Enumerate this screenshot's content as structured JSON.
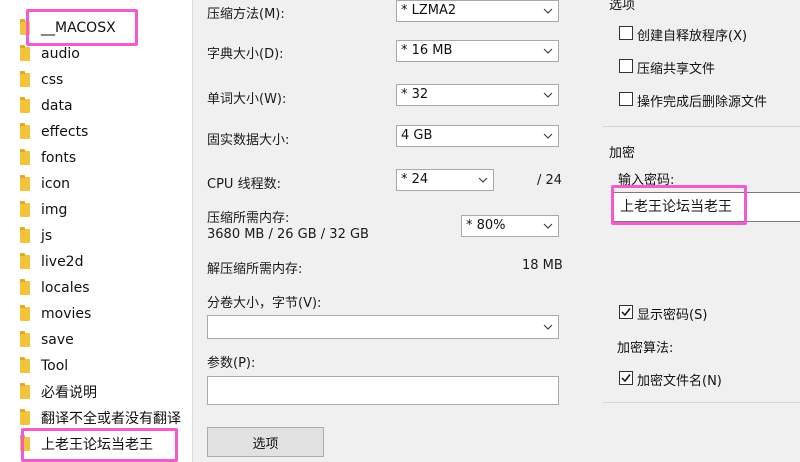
{
  "file_list": {
    "items": [
      {
        "name": "__MACOSX"
      },
      {
        "name": "audio"
      },
      {
        "name": "css"
      },
      {
        "name": "data"
      },
      {
        "name": "effects"
      },
      {
        "name": "fonts"
      },
      {
        "name": "icon"
      },
      {
        "name": "img"
      },
      {
        "name": "js"
      },
      {
        "name": "live2d"
      },
      {
        "name": "locales"
      },
      {
        "name": "movies"
      },
      {
        "name": "save"
      },
      {
        "name": "Tool"
      },
      {
        "name": "必看说明"
      },
      {
        "name": "翻译不全或者没有翻译"
      },
      {
        "name": "上老王论坛当老王"
      }
    ]
  },
  "settings": {
    "compress_method_label": "压缩方法(M):",
    "compress_method_value": "* LZMA2",
    "dict_size_label": "字典大小(D):",
    "dict_size_value": "* 16 MB",
    "word_size_label": "单词大小(W):",
    "word_size_value": "* 32",
    "solid_block_label": "固实数据大小:",
    "solid_block_value": "4 GB",
    "cpu_threads_label": "CPU 线程数:",
    "cpu_threads_value": "* 24",
    "cpu_threads_total": "/ 24",
    "mem_compress_label": "压缩所需内存:",
    "mem_compress_value": "3680 MB / 26 GB / 32 GB",
    "mem_percent_value": "* 80%",
    "mem_decompress_label": "解压缩所需内存:",
    "mem_decompress_value": "18 MB",
    "volume_label": "分卷大小，字节(V):",
    "volume_value": "",
    "params_label": "参数(P):",
    "params_value": "",
    "options_button": "选项"
  },
  "options": {
    "group_title": "选项",
    "sfx_label": "创建自释放程序(X)",
    "shared_label": "压缩共享文件",
    "delete_label": "操作完成后删除源文件"
  },
  "encryption": {
    "group_title": "加密",
    "password_label": "输入密码:",
    "password_value": "上老王论坛当老王",
    "show_password_label": "显示密码(S)",
    "algorithm_label": "加密算法:",
    "encrypt_names_label": "加密文件名(N)"
  },
  "colors": {
    "highlight": "#f25bd0",
    "folder": "#f3c33b"
  }
}
